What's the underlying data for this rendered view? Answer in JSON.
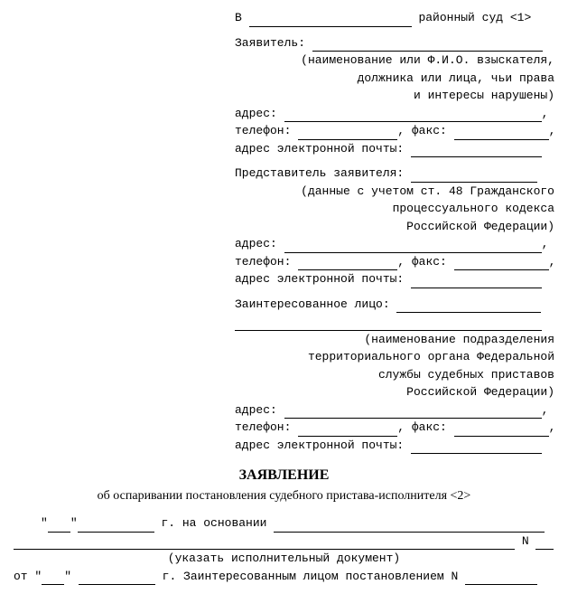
{
  "header": {
    "to_prefix": "В",
    "to_suffix": "районный суд <1>"
  },
  "applicant": {
    "label": "Заявитель:",
    "note_l1": "(наименование или Ф.И.О. взыскателя,",
    "note_l2": "должника или лица, чьи права",
    "note_l3": "и интересы нарушены)",
    "address_label": "адрес:",
    "phone_label": "телефон:",
    "fax_label": ", факс:",
    "email_label": "адрес электронной почты:"
  },
  "representative": {
    "label": "Представитель заявителя:",
    "note_l1": "(данные с учетом ст. 48 Гражданского",
    "note_l2": "процессуального кодекса",
    "note_l3": "Российской Федерации)",
    "address_label": "адрес:",
    "phone_label": "телефон:",
    "fax_label": ", факс:",
    "email_label": "адрес электронной почты:"
  },
  "interested": {
    "label": "Заинтересованное лицо:",
    "note_l1": "(наименование подразделения",
    "note_l2": "территориального органа Федеральной",
    "note_l3": "службы судебных приставов",
    "note_l4": "Российской Федерации)",
    "address_label": "адрес:",
    "phone_label": "телефон:",
    "fax_label": ", факс:",
    "email_label": "адрес электронной почты:"
  },
  "doc_title": "ЗАЯВЛЕНИЕ",
  "doc_subtitle": "об оспаривании постановления судебного пристава-исполнителя <2>",
  "basis": {
    "quote1": "\"",
    "quote2": "\"",
    "year_suffix": "г. на основании",
    "suffix_N": "N",
    "caption": "(указать исполнительный документ)",
    "from_label": "от \"",
    "from_quote2": "\"",
    "from_year": "г. Заинтересованным лицом постановлением N"
  }
}
